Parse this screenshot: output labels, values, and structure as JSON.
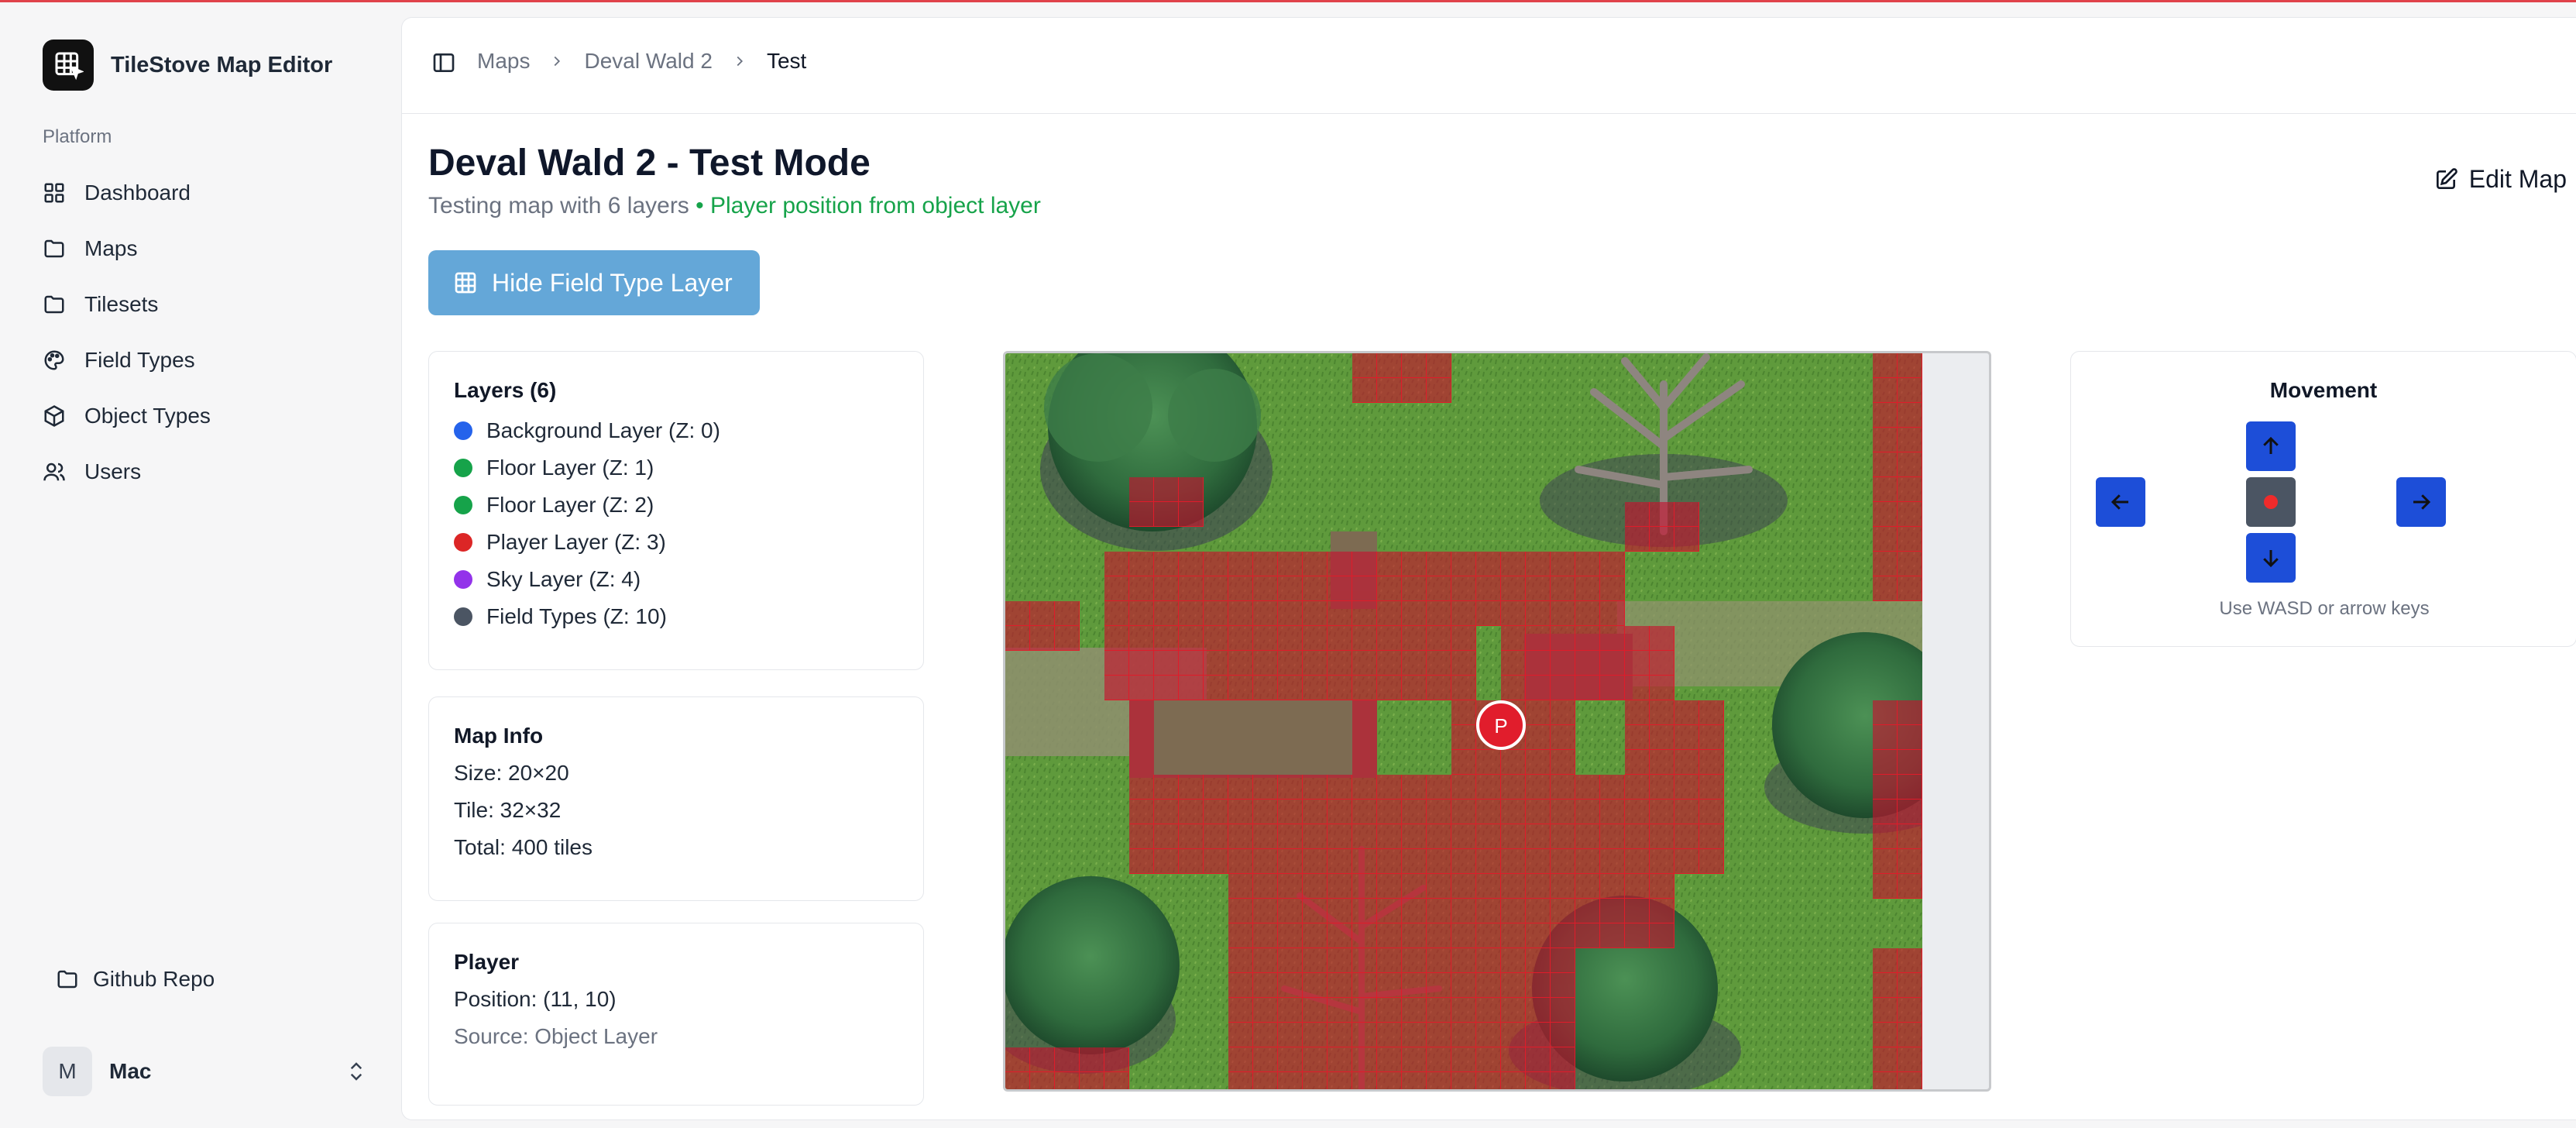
{
  "app": {
    "name": "TileStove Map Editor"
  },
  "sidebar": {
    "section_label": "Platform",
    "items": [
      {
        "label": "Dashboard",
        "icon": "grid-icon"
      },
      {
        "label": "Maps",
        "icon": "folder-icon"
      },
      {
        "label": "Tilesets",
        "icon": "folder-icon"
      },
      {
        "label": "Field Types",
        "icon": "palette-icon"
      },
      {
        "label": "Object Types",
        "icon": "box-icon"
      },
      {
        "label": "Users",
        "icon": "users-icon"
      }
    ],
    "github_label": "Github Repo",
    "user": {
      "initial": "M",
      "name": "Mac"
    }
  },
  "breadcrumb": [
    "Maps",
    "Deval Wald 2",
    "Test"
  ],
  "page": {
    "title": "Deval Wald 2 - Test Mode",
    "subtitle": "Testing map with 6 layers",
    "subtitle_highlight": "• Player position from object layer",
    "edit_label": "Edit Map",
    "toggle_label": "Hide Field Type Layer"
  },
  "layers": {
    "title": "Layers (6)",
    "items": [
      {
        "label": "Background Layer (Z: 0)",
        "color": "#2563eb"
      },
      {
        "label": "Floor Layer (Z: 1)",
        "color": "#16a34a"
      },
      {
        "label": "Floor Layer (Z: 2)",
        "color": "#16a34a"
      },
      {
        "label": "Player Layer (Z: 3)",
        "color": "#dc2626"
      },
      {
        "label": "Sky Layer (Z: 4)",
        "color": "#9333ea"
      },
      {
        "label": "Field Types (Z: 10)",
        "color": "#4b5563"
      }
    ]
  },
  "map_info": {
    "title": "Map Info",
    "size": "Size: 20×20",
    "tile": "Tile: 32×32",
    "total": "Total: 400 tiles"
  },
  "player": {
    "title": "Player",
    "position": "Position: (11, 10)",
    "source": "Source: Object Layer",
    "marker": "P"
  },
  "movement": {
    "title": "Movement",
    "hint": "Use WASD or arrow keys"
  },
  "colors": {
    "accent": "#1d4ed8",
    "toggle_button": "#64a7d8",
    "highlight": "#16a34a",
    "field_overlay": "#c8102e"
  }
}
